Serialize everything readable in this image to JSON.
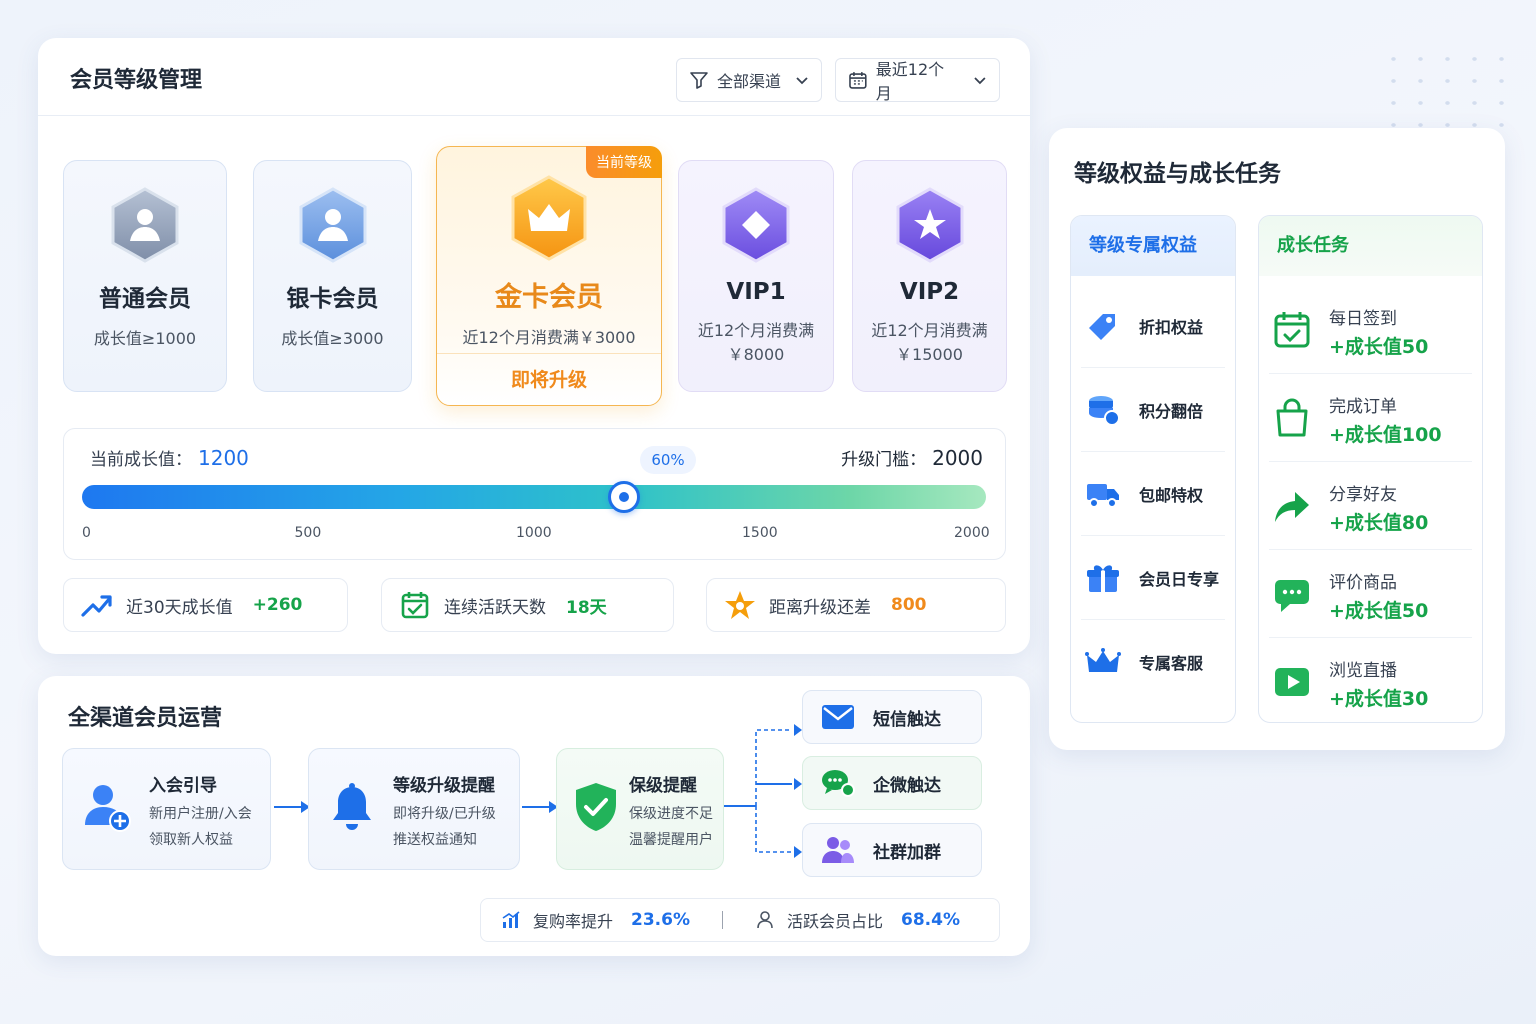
{
  "level_card": {
    "title": "会员等级管理",
    "filter_channel": "全部渠道",
    "filter_period": "最近12个月",
    "tiers": [
      {
        "name": "普通会员",
        "condition": "成长值≥1000"
      },
      {
        "name": "银卡会员",
        "condition": "成长值≥3000"
      },
      {
        "name": "金卡会员",
        "condition": "近12个月消费满￥3000",
        "tag": "当前等级",
        "action": "即将升级"
      },
      {
        "name": "VIP1",
        "condition": "近12个月消费满￥8000"
      },
      {
        "name": "VIP2",
        "condition": "近12个月消费满￥15000"
      }
    ],
    "progress": {
      "current_label": "当前成长值：",
      "current_value": "1200",
      "threshold_label": "升级门槛：",
      "threshold_value": "2000",
      "percent_label": "60%",
      "fraction": 0.6,
      "ticks": [
        "0",
        "500",
        "1000",
        "1500",
        "2000"
      ]
    },
    "stats": [
      {
        "label": "近30天成长值",
        "value": "+260"
      },
      {
        "label": "连续活跃天数",
        "value": "18天"
      },
      {
        "label": "距离升级还差",
        "value": "800"
      }
    ]
  },
  "ops_card": {
    "title": "全渠道会员运营",
    "steps": [
      {
        "title": "入会引导",
        "desc1": "新用户注册/入会",
        "desc2": "领取新人权益"
      },
      {
        "title": "等级升级提醒",
        "desc1": "即将升级/已升级",
        "desc2": "推送权益通知"
      },
      {
        "title": "保级提醒",
        "desc1": "保级进度不足",
        "desc2": "温馨提醒用户"
      }
    ],
    "touches": [
      "短信触达",
      "企微触达",
      "社群加群"
    ],
    "summary": [
      {
        "label": "复购率提升",
        "value": "23.6%"
      },
      {
        "label": "活跃会员占比",
        "value": "68.4%"
      }
    ]
  },
  "benefits_card": {
    "title": "等级权益与成长任务",
    "benefit_header": "等级专属权益",
    "task_header": "成长任务",
    "benefits": [
      "折扣权益",
      "积分翻倍",
      "包邮特权",
      "会员日专享",
      "专属客服"
    ],
    "tasks": [
      {
        "name": "每日签到",
        "reward": "+成长值50"
      },
      {
        "name": "完成订单",
        "reward": "+成长值100"
      },
      {
        "name": "分享好友",
        "reward": "+成长值80"
      },
      {
        "name": "评价商品",
        "reward": "+成长值50"
      },
      {
        "name": "浏览直播",
        "reward": "+成长值30"
      }
    ]
  },
  "colors": {
    "primary": "#1e6fe8",
    "success": "#16a34a",
    "gold": "#f08a1c",
    "vip": "#7b5ce6"
  }
}
